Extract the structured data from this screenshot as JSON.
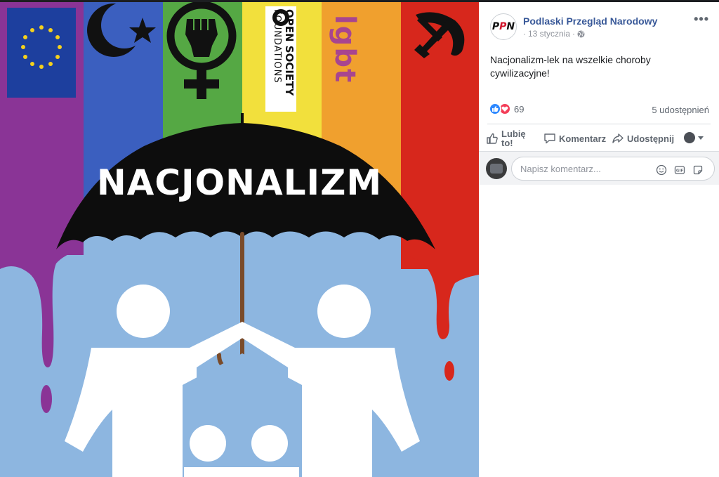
{
  "image": {
    "umbrella_text": "NACJONALIZM",
    "osf_line1": "OPEN SOCIETY",
    "osf_line2": "FOUNDATIONS",
    "lgbt_text": "lgbt"
  },
  "post": {
    "page_name": "Podlaski Przegląd Narodowy",
    "avatar_text": "PPN",
    "date": "13 stycznia",
    "separator": "·",
    "more": "•••",
    "text": "Nacjonalizm-lek na wszelkie choroby cywilizacyjne!",
    "reaction_count": "69",
    "shares": "5 udostępnień"
  },
  "actions": {
    "like_line1": "Lubię",
    "like_line2": "to!",
    "comment": "Komentarz",
    "share": "Udostępnij"
  },
  "comment_box": {
    "placeholder": "Napisz komentarz..."
  },
  "colors": {
    "link": "#385898",
    "muted": "#606770",
    "like_blue": "#2d88ff",
    "love_red": "#f33e58"
  }
}
